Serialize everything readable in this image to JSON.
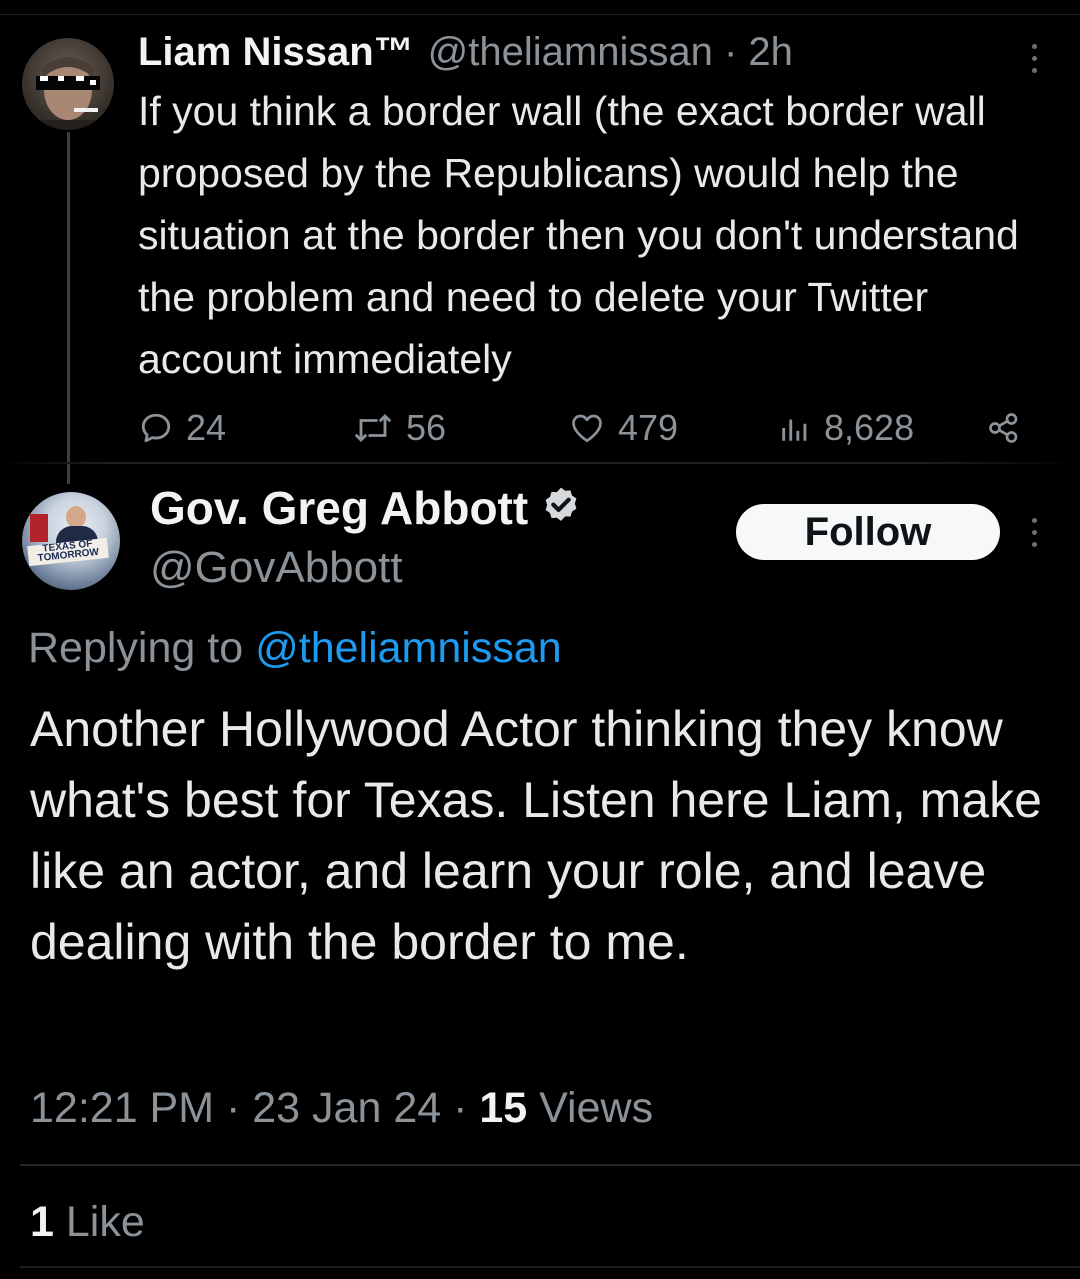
{
  "parent_tweet": {
    "display_name": "Liam Nissan™",
    "handle": "@theliamnissan",
    "time_separator": "·",
    "time": "2h",
    "text": "If you think a border wall (the exact border wall proposed by the Republicans) would help the situation at the border then you don't understand the problem and need to delete your Twitter account immediately",
    "actions": {
      "replies": "24",
      "reposts": "56",
      "likes": "479",
      "views": "8,628"
    },
    "icons": [
      "reply-icon",
      "repost-icon",
      "like-icon",
      "views-icon",
      "share-icon",
      "more-icon"
    ]
  },
  "reply_tweet": {
    "display_name": "Gov. Greg Abbott",
    "handle": "@GovAbbott",
    "verified": true,
    "avatar_banner_text": "TEXAS OF TOMORROW",
    "follow_label": "Follow",
    "replying_prefix": "Replying to",
    "replying_mention": "@theliamnissan",
    "text": "Another Hollywood Actor thinking they know what's best for Texas.  Listen here Liam, make like an actor, and learn your role, and leave dealing with the border to me.",
    "timestamp": "12:21 PM · 23 Jan 24 · ",
    "views_count": "15",
    "views_label": "Views",
    "likes_count": "1",
    "likes_label": "Like"
  },
  "colors": {
    "background": "#000000",
    "text_primary": "#e7e9ea",
    "text_secondary": "#8b9298",
    "link_blue": "#1d9bf0",
    "verified_badge": "#d6d9dc",
    "follow_bg": "#f7f9f9"
  }
}
